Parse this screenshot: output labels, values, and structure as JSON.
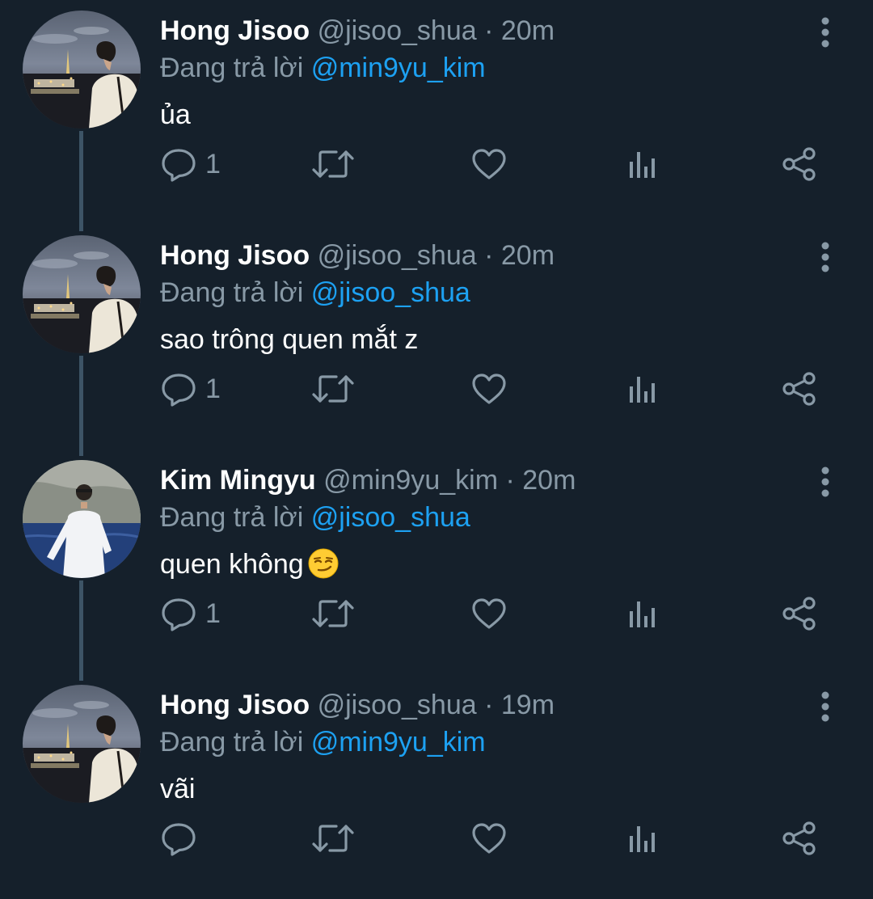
{
  "thread": {
    "tweets": [
      {
        "display_name": "Hong Jisoo",
        "handle": "@jisoo_shua",
        "separator": "·",
        "time": "20m",
        "reply_prefix": "Đang trả lời",
        "reply_to": "@min9yu_kim",
        "text": "ủa",
        "emoji": "",
        "reply_count": "1",
        "avatar": "night-city-avatar"
      },
      {
        "display_name": "Hong Jisoo",
        "handle": "@jisoo_shua",
        "separator": "·",
        "time": "20m",
        "reply_prefix": "Đang trả lời",
        "reply_to": "@jisoo_shua",
        "text": "sao trông quen mắt z",
        "emoji": "",
        "reply_count": "1",
        "avatar": "night-city-avatar"
      },
      {
        "display_name": "Kim Mingyu",
        "handle": "@min9yu_kim",
        "separator": "·",
        "time": "20m",
        "reply_prefix": "Đang trả lời",
        "reply_to": "@jisoo_shua",
        "text": "quen không",
        "emoji": "smirking-face",
        "reply_count": "1",
        "avatar": "seaside-avatar"
      },
      {
        "display_name": "Hong Jisoo",
        "handle": "@jisoo_shua",
        "separator": "·",
        "time": "19m",
        "reply_prefix": "Đang trả lời",
        "reply_to": "@min9yu_kim",
        "text": "vãi",
        "emoji": "",
        "reply_count": "",
        "avatar": "night-city-avatar"
      }
    ]
  },
  "icons": {
    "reply": "reply-icon",
    "retweet": "retweet-icon",
    "like": "like-icon",
    "analytics": "analytics-icon",
    "share": "share-icon",
    "more": "more-vertical-icon"
  },
  "colors": {
    "background": "#15202b",
    "text": "#ffffff",
    "secondary": "#8899a6",
    "mention": "#1da1f2",
    "thread_line": "#3d5466"
  }
}
